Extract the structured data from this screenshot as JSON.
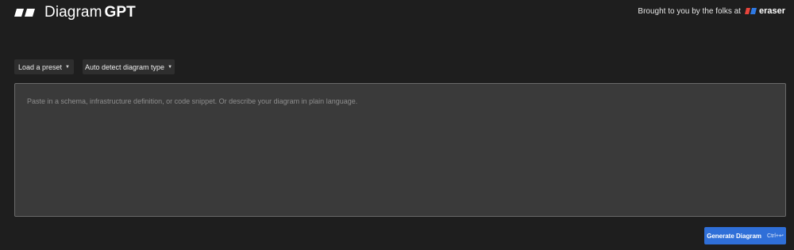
{
  "header": {
    "brand_light": "Diagram",
    "brand_bold": "GPT",
    "credit_text": "Brought to you by the folks at",
    "credit_brand": "eraser"
  },
  "controls": {
    "preset_label": "Load a preset",
    "detect_label": "Auto detect diagram type",
    "caret_icon": "caret-down-icon"
  },
  "prompt": {
    "placeholder": "Paste in a schema, infrastructure definition, or code snippet. Or describe your diagram in plain language.",
    "value": ""
  },
  "generate": {
    "label": "Generate Diagram",
    "shortcut": "Ctrl+↩"
  },
  "colors": {
    "background": "#1e1e1e",
    "accent": "#2f6fd8",
    "eraser_red": "#e8453c",
    "eraser_blue": "#2f7ae5"
  }
}
